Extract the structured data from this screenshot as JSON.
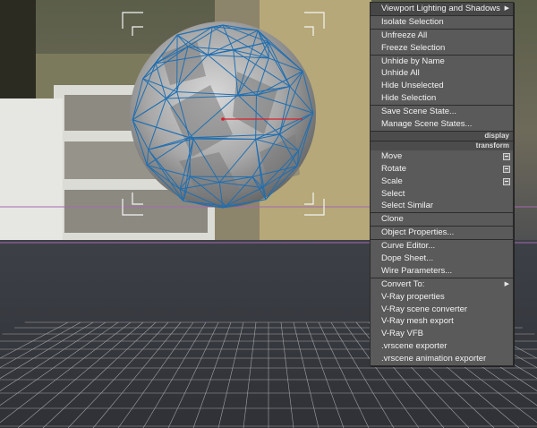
{
  "quad_menu": {
    "groups": [
      {
        "header": "",
        "items": [
          {
            "label": "Viewport Lighting and Shadows",
            "submenu": true,
            "highlighted": true
          }
        ]
      },
      {
        "header": "",
        "items": [
          {
            "label": "Isolate Selection"
          }
        ]
      },
      {
        "header": "",
        "items": [
          {
            "label": "Unfreeze All"
          },
          {
            "label": "Freeze Selection"
          }
        ]
      },
      {
        "header": "",
        "items": [
          {
            "label": "Unhide by Name"
          },
          {
            "label": "Unhide All"
          },
          {
            "label": "Hide Unselected"
          },
          {
            "label": "Hide Selection"
          }
        ]
      },
      {
        "header": "",
        "items": [
          {
            "label": "Save Scene State..."
          },
          {
            "label": "Manage Scene States..."
          }
        ]
      },
      {
        "header": "display",
        "items": []
      },
      {
        "header": "transform",
        "items": [
          {
            "label": "Move",
            "options": true
          },
          {
            "label": "Rotate",
            "options": true
          },
          {
            "label": "Scale",
            "options": true
          },
          {
            "label": "Select"
          },
          {
            "label": "Select Similar"
          }
        ]
      },
      {
        "header": "",
        "items": [
          {
            "label": "Clone"
          }
        ]
      },
      {
        "header": "",
        "items": [
          {
            "label": "Object Properties..."
          }
        ]
      },
      {
        "header": "",
        "items": [
          {
            "label": "Curve Editor..."
          },
          {
            "label": "Dope Sheet..."
          },
          {
            "label": "Wire Parameters..."
          }
        ]
      },
      {
        "header": "",
        "items": [
          {
            "label": "Convert To:",
            "submenu": true
          },
          {
            "label": "V-Ray properties"
          },
          {
            "label": "V-Ray scene converter"
          },
          {
            "label": "V-Ray mesh export"
          },
          {
            "label": "V-Ray VFB"
          },
          {
            "label": ".vrscene exporter"
          },
          {
            "label": ".vrscene animation exporter"
          }
        ]
      }
    ]
  },
  "colors": {
    "wireframe": "#1f6fb2",
    "gizmo_x_axis": "#d8202a",
    "grid": "#c8c8c8",
    "horizon_line": "#a36ab0"
  },
  "icons": {
    "submenu": "triangle-right-icon",
    "options": "option-box-icon"
  }
}
